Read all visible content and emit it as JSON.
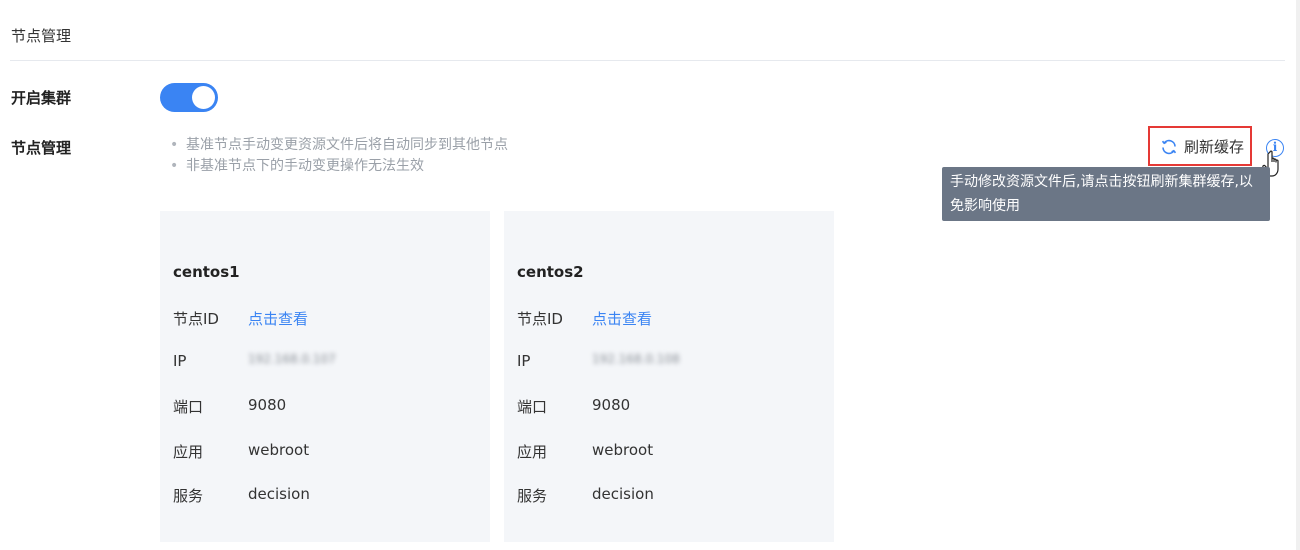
{
  "page": {
    "title": "节点管理"
  },
  "cluster": {
    "label": "开启集群",
    "enabled": true
  },
  "nodes_section": {
    "label": "节点管理",
    "tips": [
      "基准节点手动变更资源文件后将自动同步到其他节点",
      "非基准节点下的手动变更操作无法生效"
    ],
    "refresh_label": "刷新缓存",
    "info_icon": "i",
    "tooltip": "手动修改资源文件后,请点击按钮刷新集群缓存,以免影响使用"
  },
  "nodes": [
    {
      "name": "centos1",
      "fields": {
        "node_id_label": "节点ID",
        "node_id_value": "点击查看",
        "ip_label": "IP",
        "ip_value": "192.168.0.107",
        "port_label": "端口",
        "port_value": "9080",
        "app_label": "应用",
        "app_value": "webroot",
        "service_label": "服务",
        "service_value": "decision"
      }
    },
    {
      "name": "centos2",
      "fields": {
        "node_id_label": "节点ID",
        "node_id_value": "点击查看",
        "ip_label": "IP",
        "ip_value": "192.168.0.108",
        "port_label": "端口",
        "port_value": "9080",
        "app_label": "应用",
        "app_value": "webroot",
        "service_label": "服务",
        "service_value": "decision"
      }
    }
  ],
  "colors": {
    "accent": "#3a84f3",
    "highlight_border": "#e53935",
    "tooltip_bg": "#6b7686",
    "card_bg": "#f4f6f9"
  },
  "icons": {
    "refresh": "refresh-icon",
    "info": "info-icon",
    "pointer": "hand-cursor-icon"
  }
}
